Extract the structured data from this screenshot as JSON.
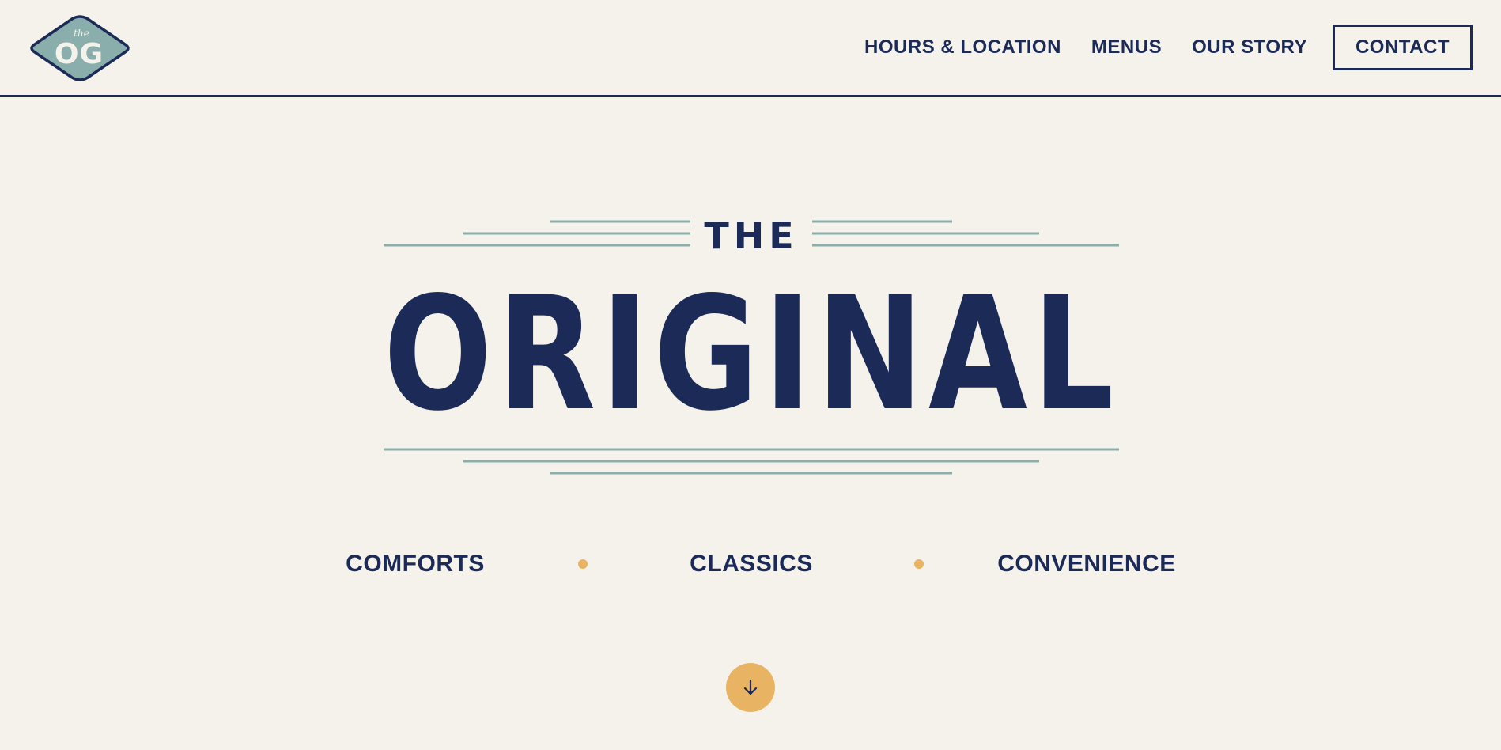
{
  "header": {
    "logo": {
      "small_text": "the",
      "big_text": "OG",
      "colors": {
        "fill": "#8aaeab",
        "outline": "#1b2a57",
        "text": "#f4f2eb"
      }
    },
    "nav": {
      "items": [
        {
          "label": "HOURS & LOCATION"
        },
        {
          "label": "MENUS"
        },
        {
          "label": "OUR STORY"
        }
      ],
      "contact_label": "CONTACT"
    }
  },
  "hero": {
    "line1": "THE",
    "line2": "ORIGINAL",
    "colors": {
      "text": "#1b2a57",
      "rules": "#8aaeab"
    },
    "tagline": [
      "COMFORTS",
      "CLASSICS",
      "CONVENIENCE"
    ],
    "separator_color": "#e8b463",
    "scroll_button_icon": "arrow-down-icon"
  },
  "theme": {
    "background": "#f4f2eb",
    "primary": "#1b2a57",
    "accent": "#e8b463",
    "teal": "#8aaeab"
  }
}
